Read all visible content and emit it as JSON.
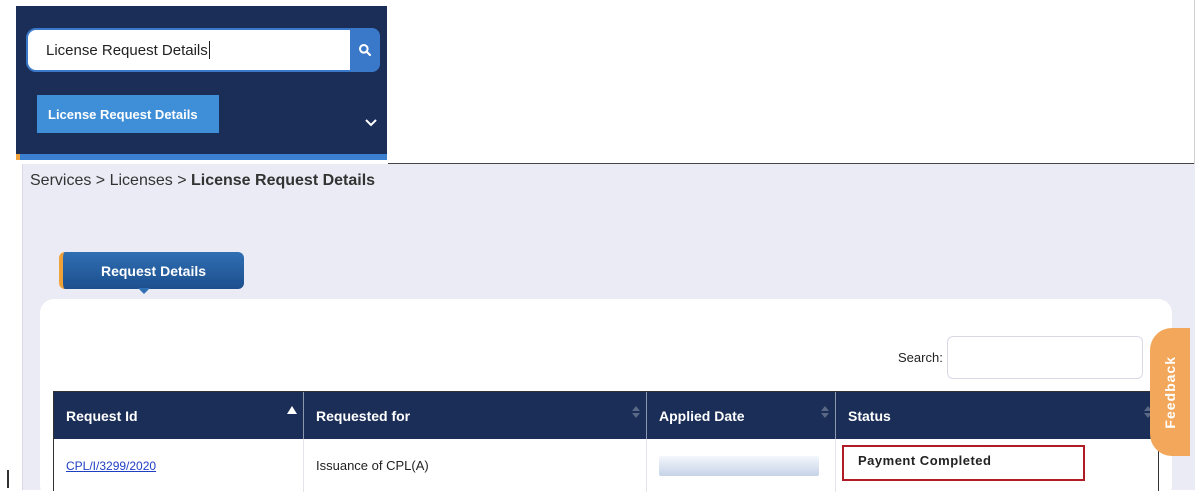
{
  "menu": {
    "search_value": "License Request Details",
    "result_item": "License Request Details"
  },
  "breadcrumb": {
    "services": "Services",
    "sep1": " > ",
    "licenses": "Licenses",
    "sep2": " > ",
    "current": "License Request Details"
  },
  "tab": {
    "label": "Request Details"
  },
  "table": {
    "search_label": "Search:",
    "search_value": "",
    "columns": [
      "Request Id",
      "Requested for",
      "Applied Date",
      "Status"
    ],
    "rows": [
      {
        "request_id": "CPL/I/3299/2020",
        "requested_for": "Issuance of CPL(A)",
        "applied_date": "",
        "status": "Payment Completed"
      }
    ]
  },
  "feedback": {
    "label": "Feedback"
  },
  "colors": {
    "navy": "#1b2e57",
    "accent_blue": "#3a78c9",
    "orange": "#f0a23a",
    "status_border": "#b01c25"
  },
  "icons": [
    "search-icon",
    "chevron-down-icon",
    "sort-asc-icon",
    "sort-icon"
  ]
}
